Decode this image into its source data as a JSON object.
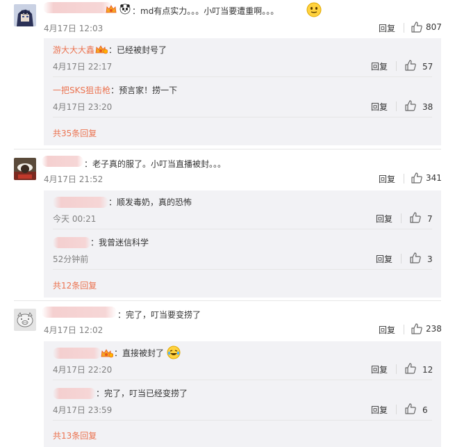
{
  "threads": [
    {
      "avatar": "anime-avatar",
      "text": "：md有点实力。。。小叮当要遭重啊。。。",
      "time": "4月17日 12:03",
      "reply_label": "回复",
      "likes": "807",
      "replies": [
        {
          "name": "游大大大鑫",
          "text": "：已经被封号了",
          "time": "4月17日 22:17",
          "reply_label": "回复",
          "likes": "57"
        },
        {
          "name": "一把SKS狙击枪",
          "text": "：预言家！捞一下",
          "time": "4月17日 23:20",
          "reply_label": "回复",
          "likes": "38"
        }
      ],
      "more": "共35条回复"
    },
    {
      "avatar": "game-avatar",
      "text": "：老子真的服了。小叮当直播被封。。。",
      "time": "4月17日 21:52",
      "reply_label": "回复",
      "likes": "341",
      "replies": [
        {
          "name": "",
          "text": "：顺发毒奶，真的恐怖",
          "time": "今天 00:21",
          "reply_label": "回复",
          "likes": "7"
        },
        {
          "name": "",
          "text": "：我曾迷信科学",
          "time": "52分钟前",
          "reply_label": "回复",
          "likes": "3"
        }
      ],
      "more": "共12条回复"
    },
    {
      "avatar": "pig-avatar",
      "text": "：完了，叮当要变捞了",
      "time": "4月17日 12:02",
      "reply_label": "回复",
      "likes": "238",
      "replies": [
        {
          "name": "",
          "text": "：直接被封了",
          "time": "4月17日 22:20",
          "reply_label": "回复",
          "likes": "12"
        },
        {
          "name": "",
          "text": "：完了，叮当已经变捞了",
          "time": "4月17日 23:59",
          "reply_label": "回复",
          "likes": "6"
        }
      ],
      "more": "共13条回复"
    }
  ]
}
